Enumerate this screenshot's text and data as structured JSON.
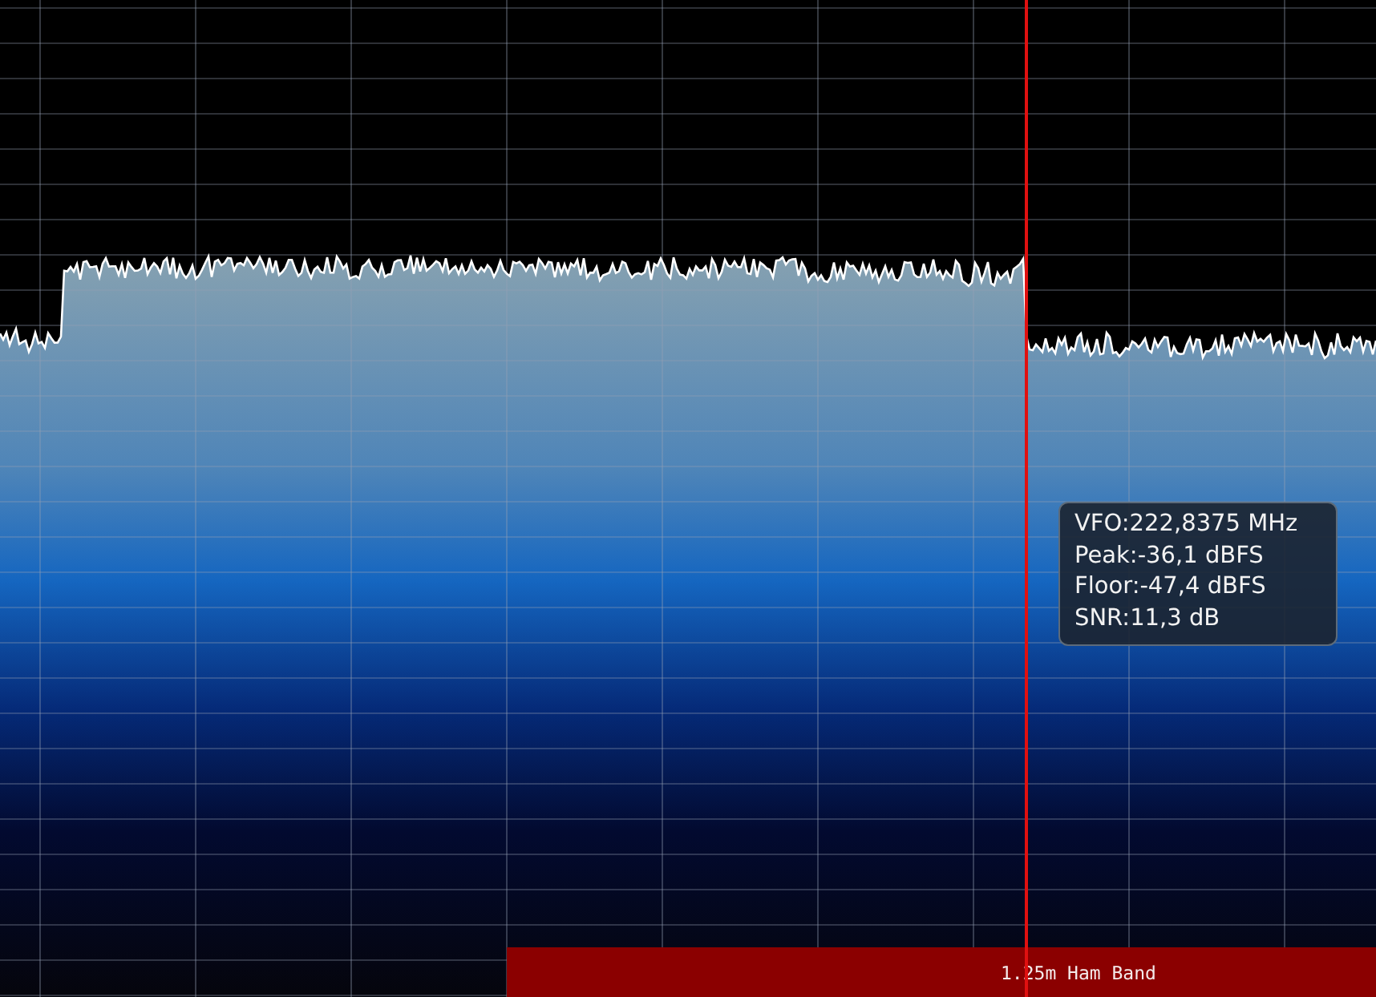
{
  "tooltip": {
    "lines": [
      "VFO:222,8375 MHz",
      "Peak:-36,1 dBFS",
      "Floor:-47,4 dBFS",
      "SNR:11,3 dB"
    ]
  },
  "band": {
    "label": "1.25m Ham Band"
  }
}
